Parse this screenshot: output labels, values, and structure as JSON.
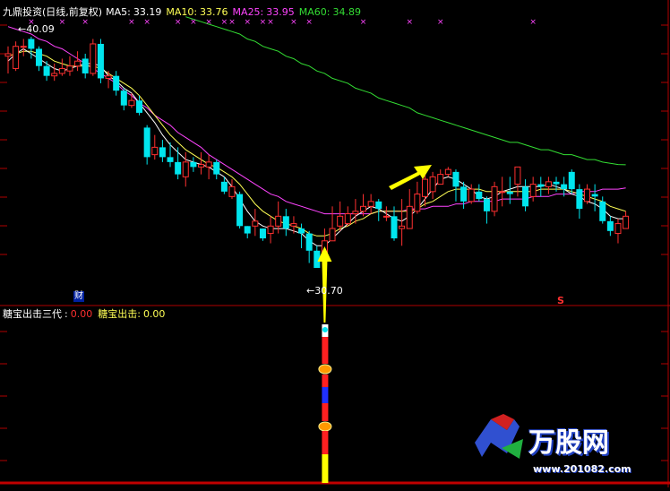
{
  "header": {
    "title": "九鼎投资(日线,前复权)",
    "ma5": {
      "label": "MA5:",
      "value": "33.19",
      "color": "#ffffff"
    },
    "ma10": {
      "label": "MA10:",
      "value": "33.76",
      "color": "#ffff55"
    },
    "ma25": {
      "label": "MA25:",
      "value": "33.95",
      "color": "#ff44ff"
    },
    "ma60": {
      "label": "MA60:",
      "value": "34.89",
      "color": "#33dd33"
    }
  },
  "sub_header": {
    "name": "糖宝出击三代",
    "value1": "0.00",
    "label2": "糖宝出击:",
    "value2": "0.00"
  },
  "annotations": {
    "high_label": "40.09",
    "low_label": "30.70",
    "cai_marker": "财",
    "s_marker": "S"
  },
  "watermark": {
    "name": "万股网",
    "url": "www.201082.com"
  },
  "colors": {
    "up": "#ff3030",
    "down": "#00e5ee",
    "frame": "#b00000",
    "arrow": "#ffff00",
    "signal_red": "#ff2020",
    "signal_blue": "#2030ff",
    "signal_yellow": "#ffff00"
  },
  "chart_data": {
    "type": "candlestick",
    "title": "九鼎投资(日线,前复权)",
    "ylim": [
      29.5,
      41
    ],
    "extreme_high": 40.09,
    "extreme_low": 30.7,
    "candles": [
      [
        39.3,
        39.4,
        38.6,
        39.7
      ],
      [
        38.8,
        39.7,
        38.7,
        39.9
      ],
      [
        39.7,
        39.7,
        39.3,
        40.0
      ],
      [
        40.0,
        39.6,
        39.2,
        40.09
      ],
      [
        39.6,
        38.9,
        38.7,
        39.7
      ],
      [
        38.9,
        38.5,
        38.3,
        39.1
      ],
      [
        38.5,
        38.6,
        38.3,
        39.0
      ],
      [
        38.6,
        38.8,
        38.5,
        39.2
      ],
      [
        38.7,
        38.9,
        38.5,
        39.3
      ],
      [
        38.9,
        39.1,
        38.7,
        39.5
      ],
      [
        39.2,
        38.6,
        38.4,
        39.4
      ],
      [
        38.6,
        39.8,
        38.5,
        40.0
      ],
      [
        39.8,
        38.4,
        38.2,
        40.0
      ],
      [
        38.4,
        38.5,
        38.0,
        38.7
      ],
      [
        38.5,
        37.9,
        37.7,
        38.7
      ],
      [
        37.9,
        37.3,
        37.1,
        38.0
      ],
      [
        37.3,
        37.5,
        37.2,
        37.8
      ],
      [
        37.5,
        37.0,
        36.9,
        37.7
      ],
      [
        36.4,
        35.2,
        34.9,
        36.5
      ],
      [
        35.3,
        35.6,
        35.1,
        36.1
      ],
      [
        35.6,
        35.2,
        35.0,
        35.9
      ],
      [
        35.2,
        35.0,
        34.8,
        35.8
      ],
      [
        35.0,
        34.5,
        34.3,
        35.6
      ],
      [
        34.4,
        35.0,
        34.0,
        35.4
      ],
      [
        35.0,
        34.8,
        34.6,
        35.2
      ],
      [
        34.8,
        34.9,
        34.5,
        35.4
      ],
      [
        34.8,
        35.0,
        34.3,
        35.3
      ],
      [
        35.0,
        34.5,
        34.3,
        35.1
      ],
      [
        34.2,
        33.8,
        33.7,
        34.4
      ],
      [
        33.6,
        34.0,
        33.5,
        34.3
      ],
      [
        33.7,
        32.4,
        32.3,
        33.8
      ],
      [
        32.4,
        32.1,
        31.9,
        32.4
      ],
      [
        32.4,
        32.6,
        32.0,
        33.1
      ],
      [
        32.3,
        31.9,
        31.8,
        32.3
      ],
      [
        32.1,
        32.4,
        31.7,
        32.8
      ],
      [
        32.4,
        32.8,
        32.1,
        33.4
      ],
      [
        32.8,
        32.3,
        32.0,
        33.1
      ],
      [
        32.4,
        32.5,
        32.1,
        32.8
      ],
      [
        32.3,
        32.1,
        31.5,
        32.5
      ],
      [
        32.1,
        31.4,
        30.9,
        32.2
      ],
      [
        31.4,
        30.7,
        30.7,
        31.6
      ],
      [
        31.3,
        31.8,
        30.7,
        32.3
      ],
      [
        31.8,
        32.3,
        31.8,
        33.2
      ],
      [
        32.4,
        32.8,
        32.2,
        33.4
      ],
      [
        32.5,
        32.9,
        32.4,
        33.2
      ],
      [
        32.9,
        33.0,
        32.5,
        33.5
      ],
      [
        33.0,
        33.2,
        32.8,
        33.7
      ],
      [
        33.2,
        33.4,
        32.9,
        33.7
      ],
      [
        33.4,
        33.1,
        32.6,
        33.5
      ],
      [
        32.8,
        32.8,
        32.6,
        33.2
      ],
      [
        32.8,
        31.9,
        31.8,
        33.2
      ],
      [
        32.3,
        32.4,
        31.6,
        33.5
      ],
      [
        32.3,
        33.2,
        32.5,
        33.9
      ],
      [
        33.0,
        33.7,
        32.9,
        34.2
      ],
      [
        33.6,
        34.3,
        33.2,
        34.6
      ],
      [
        33.8,
        34.4,
        33.5,
        34.6
      ],
      [
        34.1,
        34.5,
        34.3,
        34.7
      ],
      [
        34.5,
        34.7,
        34.4,
        34.8
      ],
      [
        34.6,
        34.0,
        33.4,
        34.7
      ],
      [
        34.0,
        33.4,
        33.1,
        34.2
      ],
      [
        33.4,
        33.9,
        33.3,
        34.1
      ],
      [
        33.8,
        33.5,
        33.4,
        34.1
      ],
      [
        33.5,
        33.0,
        32.5,
        33.6
      ],
      [
        33.0,
        34.0,
        32.8,
        34.2
      ],
      [
        33.8,
        33.8,
        33.2,
        34.4
      ],
      [
        33.8,
        33.7,
        33.3,
        34.4
      ],
      [
        34.1,
        34.8,
        33.6,
        34.8
      ],
      [
        34.0,
        33.2,
        33.0,
        34.3
      ],
      [
        33.6,
        34.1,
        33.4,
        34.4
      ],
      [
        34.1,
        34.0,
        33.6,
        34.4
      ],
      [
        34.0,
        34.2,
        33.7,
        34.4
      ],
      [
        34.2,
        34.1,
        33.8,
        34.4
      ],
      [
        34.1,
        33.9,
        33.6,
        34.4
      ],
      [
        34.6,
        33.9,
        33.7,
        34.7
      ],
      [
        33.9,
        33.1,
        32.7,
        34.1
      ],
      [
        33.4,
        33.9,
        33.3,
        34.1
      ],
      [
        33.7,
        33.6,
        33.0,
        34.1
      ],
      [
        33.4,
        32.6,
        32.5,
        33.6
      ],
      [
        32.6,
        32.2,
        32.0,
        32.8
      ],
      [
        32.1,
        32.5,
        31.7,
        32.7
      ],
      [
        32.3,
        32.8,
        32.4,
        33.0
      ]
    ],
    "ma5": [
      39.1,
      39.4,
      39.6,
      39.4,
      39.2,
      39.0,
      38.8,
      38.7,
      38.8,
      38.9,
      39.0,
      39.0,
      38.9,
      38.5,
      38.3,
      38.0,
      37.8,
      37.4,
      37.0,
      36.6,
      36.1,
      35.7,
      35.4,
      35.1,
      35.0,
      34.9,
      34.8,
      34.6,
      34.4,
      34.0,
      33.5,
      33.0,
      32.6,
      32.4,
      32.3,
      32.3,
      32.3,
      32.2,
      32.1,
      31.8,
      31.6,
      31.6,
      31.9,
      32.2,
      32.5,
      32.8,
      33.0,
      33.2,
      33.1,
      32.9,
      32.7,
      32.6,
      32.8,
      33.1,
      33.5,
      33.9,
      34.3,
      34.4,
      34.3,
      34.1,
      33.9,
      33.6,
      33.5,
      33.6,
      33.8,
      33.9,
      34.0,
      34.0,
      34.0,
      34.0,
      34.1,
      34.0,
      33.9,
      33.7,
      33.6,
      33.4,
      33.3,
      33.1,
      32.8,
      32.7,
      32.7
    ],
    "ma10": [
      39.3,
      39.4,
      39.5,
      39.5,
      39.4,
      39.3,
      39.1,
      39.0,
      38.9,
      38.9,
      38.9,
      38.9,
      38.8,
      38.6,
      38.4,
      38.2,
      38.0,
      37.7,
      37.3,
      36.9,
      36.5,
      36.1,
      35.8,
      35.5,
      35.3,
      35.1,
      34.9,
      34.8,
      34.6,
      34.4,
      34.1,
      33.7,
      33.3,
      33.0,
      32.8,
      32.6,
      32.5,
      32.4,
      32.3,
      32.1,
      32.0,
      32.0,
      32.1,
      32.3,
      32.4,
      32.6,
      32.7,
      32.9,
      33.0,
      33.0,
      33.0,
      33.0,
      33.0,
      33.1,
      33.3,
      33.4,
      33.6,
      33.8,
      33.9,
      33.9,
      33.9,
      33.9,
      33.8,
      33.8,
      33.8,
      33.8,
      33.8,
      33.8,
      33.8,
      33.9,
      33.9,
      33.9,
      33.9,
      33.8,
      33.7,
      33.6,
      33.5,
      33.4,
      33.2,
      33.1,
      33.0
    ],
    "ma25": [
      40.5,
      40.4,
      40.3,
      40.2,
      40.0,
      39.9,
      39.7,
      39.6,
      39.4,
      39.2,
      39.0,
      38.8,
      38.6,
      38.4,
      38.2,
      37.9,
      37.7,
      37.4,
      37.2,
      36.9,
      36.7,
      36.5,
      36.2,
      36.0,
      35.8,
      35.6,
      35.3,
      35.1,
      34.9,
      34.7,
      34.5,
      34.3,
      34.1,
      33.9,
      33.7,
      33.6,
      33.4,
      33.3,
      33.2,
      33.1,
      33.0,
      32.9,
      32.9,
      32.9,
      32.9,
      32.9,
      32.9,
      32.9,
      33.0,
      33.0,
      33.0,
      33.0,
      33.1,
      33.1,
      33.1,
      33.2,
      33.2,
      33.2,
      33.3,
      33.3,
      33.4,
      33.4,
      33.4,
      33.4,
      33.5,
      33.5,
      33.5,
      33.5,
      33.6,
      33.6,
      33.6,
      33.7,
      33.7,
      33.7,
      33.8,
      33.8,
      33.8,
      33.9,
      33.9,
      33.9,
      33.95
    ],
    "ma60": [
      null,
      null,
      null,
      null,
      null,
      null,
      null,
      null,
      null,
      null,
      null,
      null,
      null,
      null,
      null,
      null,
      null,
      null,
      null,
      null,
      null,
      null,
      null,
      40.9,
      40.8,
      40.7,
      40.6,
      40.5,
      40.4,
      40.3,
      40.2,
      40.0,
      39.9,
      39.7,
      39.6,
      39.5,
      39.3,
      39.2,
      39.0,
      38.9,
      38.7,
      38.6,
      38.4,
      38.3,
      38.2,
      38.0,
      37.9,
      37.8,
      37.6,
      37.5,
      37.4,
      37.3,
      37.2,
      37.0,
      36.9,
      36.8,
      36.7,
      36.6,
      36.5,
      36.4,
      36.3,
      36.2,
      36.1,
      36.0,
      35.9,
      35.8,
      35.8,
      35.7,
      35.6,
      35.5,
      35.5,
      35.4,
      35.3,
      35.3,
      35.2,
      35.1,
      35.1,
      35.0,
      34.95,
      34.9,
      34.89
    ],
    "x_markers": [
      3,
      7,
      10,
      16,
      18,
      22,
      24,
      26,
      28,
      29,
      31,
      33,
      34,
      37,
      39,
      46,
      52,
      56,
      68
    ],
    "signal_index": 41
  }
}
